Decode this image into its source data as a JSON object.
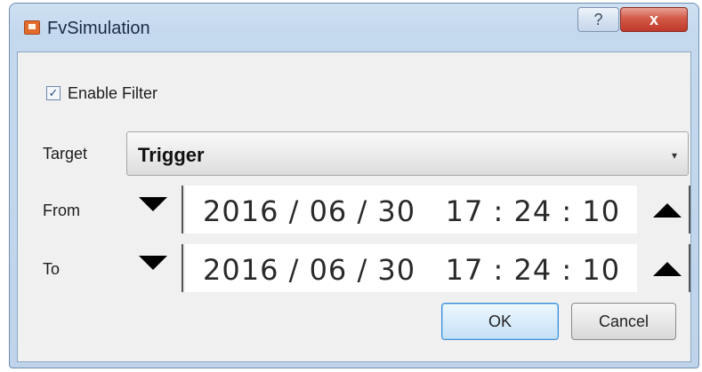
{
  "window": {
    "title": "FvSimulation",
    "help_label": "?",
    "close_label": "x"
  },
  "filter": {
    "enable_label": "Enable Filter",
    "checked": true,
    "check_mark": "✓"
  },
  "target": {
    "label": "Target",
    "value": "Trigger",
    "arrow": "▾"
  },
  "from": {
    "label": "From",
    "value": "2016 / 06 / 30   17 : 24 : 10"
  },
  "to": {
    "label": "To",
    "value": "2016 / 06 / 30   17 : 24 : 10"
  },
  "buttons": {
    "ok": "OK",
    "cancel": "Cancel"
  },
  "colors": {
    "title_bar": "#c4d8ee",
    "close_button": "#c0392b",
    "ok_border": "#3c8dd8",
    "client_bg": "#f0f0f0"
  }
}
